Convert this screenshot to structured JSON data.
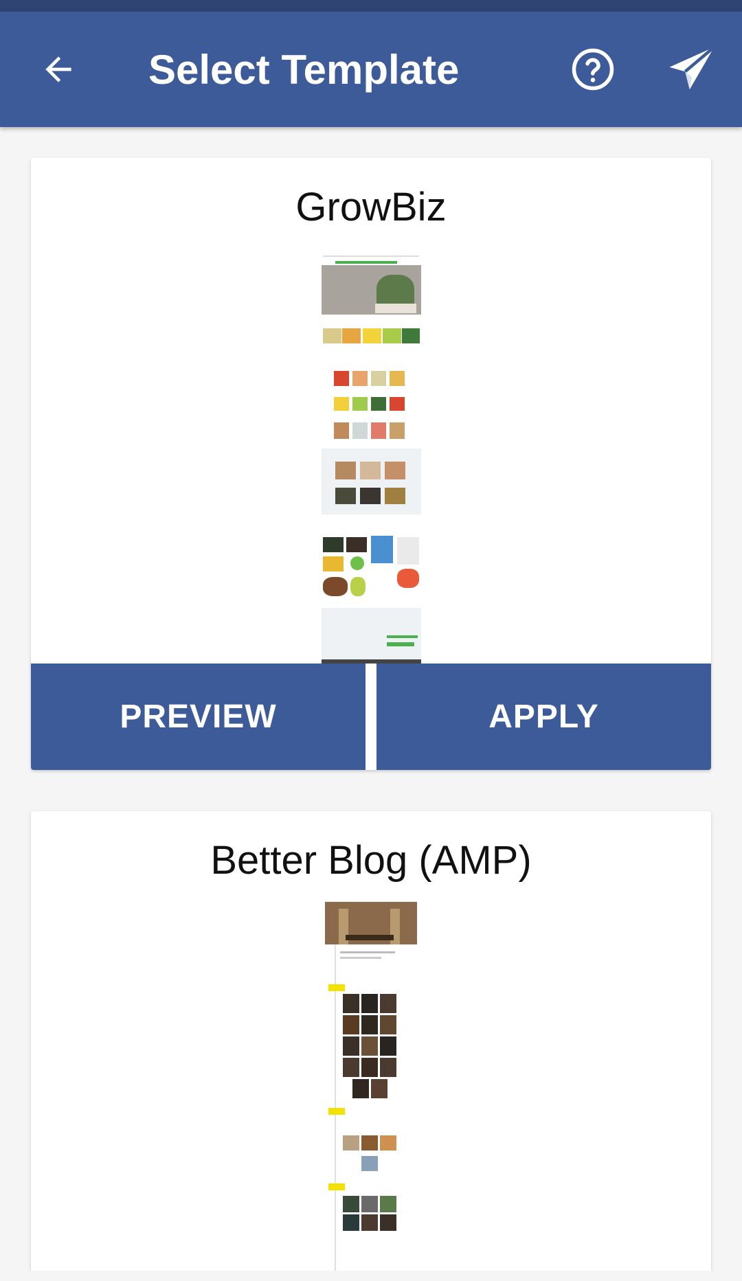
{
  "app_bar": {
    "title": "Select Template",
    "icons": {
      "back": "arrow-left-icon",
      "help": "help-circle-icon",
      "send": "paper-plane-icon"
    },
    "background": "#3d5a99",
    "status_bar_color": "#2f4473"
  },
  "templates": [
    {
      "name": "GrowBiz",
      "preview_label": "PREVIEW",
      "apply_label": "APPLY"
    },
    {
      "name": "Better Blog (AMP)"
    }
  ]
}
